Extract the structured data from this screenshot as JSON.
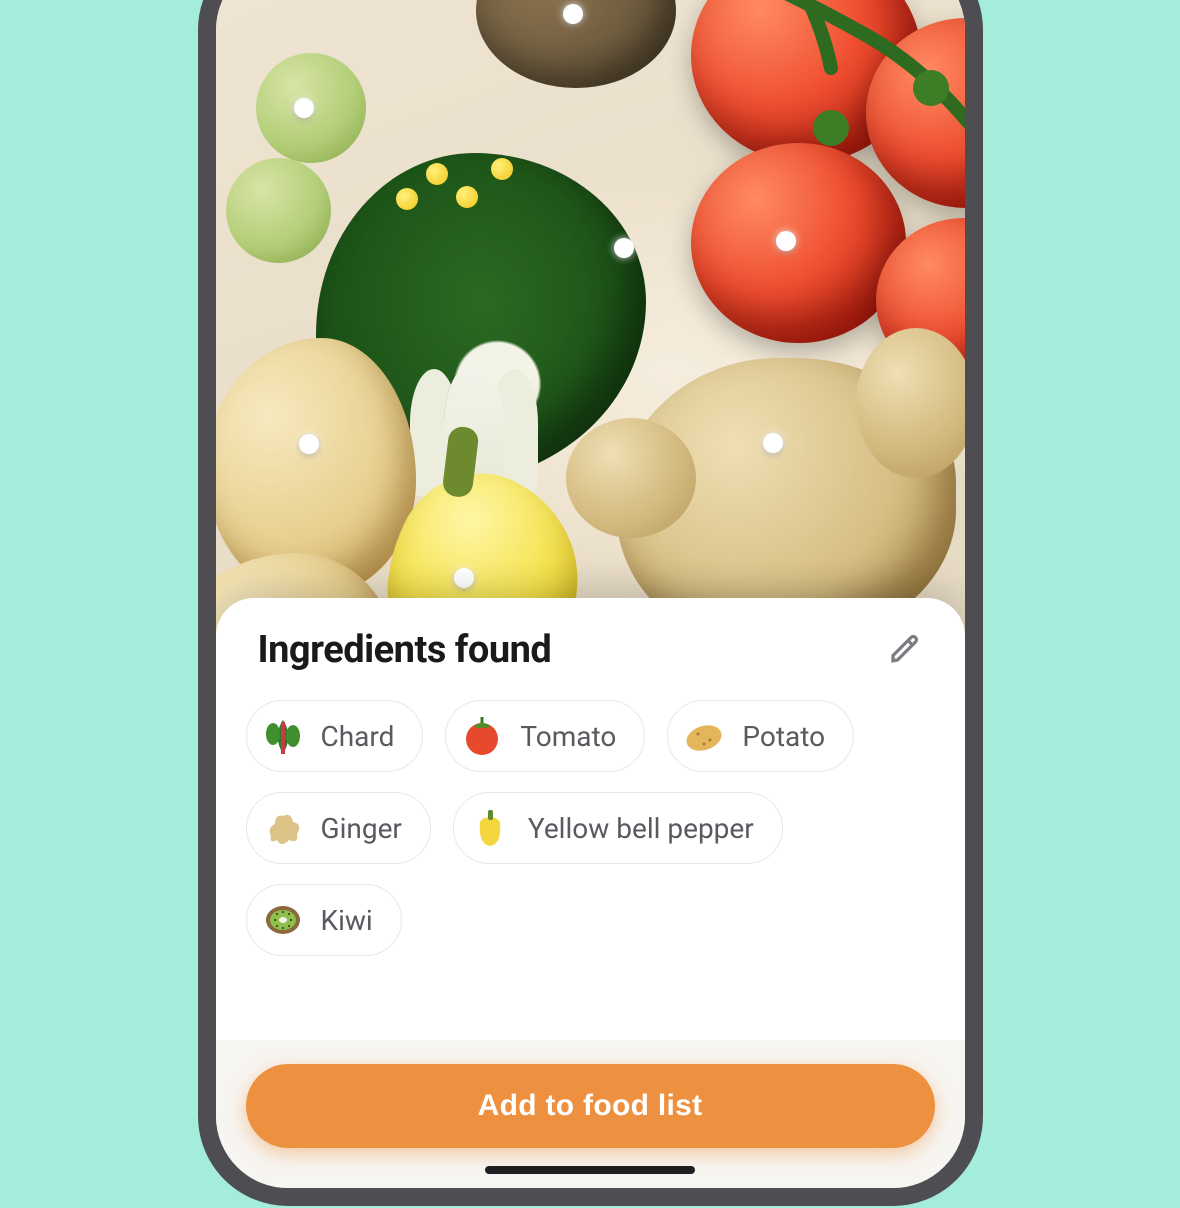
{
  "sheet": {
    "title": "Ingredients found",
    "edit_icon": "pencil-icon"
  },
  "ingredients": [
    {
      "label": "Chard",
      "icon": "chard-icon"
    },
    {
      "label": "Tomato",
      "icon": "tomato-icon"
    },
    {
      "label": "Potato",
      "icon": "potato-icon"
    },
    {
      "label": "Ginger",
      "icon": "ginger-icon"
    },
    {
      "label": "Yellow bell pepper",
      "icon": "yellow-bell-pepper-icon"
    },
    {
      "label": "Kiwi",
      "icon": "kiwi-icon"
    }
  ],
  "cta": {
    "label": "Add to food list"
  },
  "colors": {
    "accent": "#ed9140",
    "page_bg": "#a4ecdc"
  },
  "detection_dots": [
    {
      "target": "kiwi"
    },
    {
      "target": "sprout"
    },
    {
      "target": "chard"
    },
    {
      "target": "tomato"
    },
    {
      "target": "potato"
    },
    {
      "target": "ginger"
    },
    {
      "target": "pepper"
    }
  ]
}
